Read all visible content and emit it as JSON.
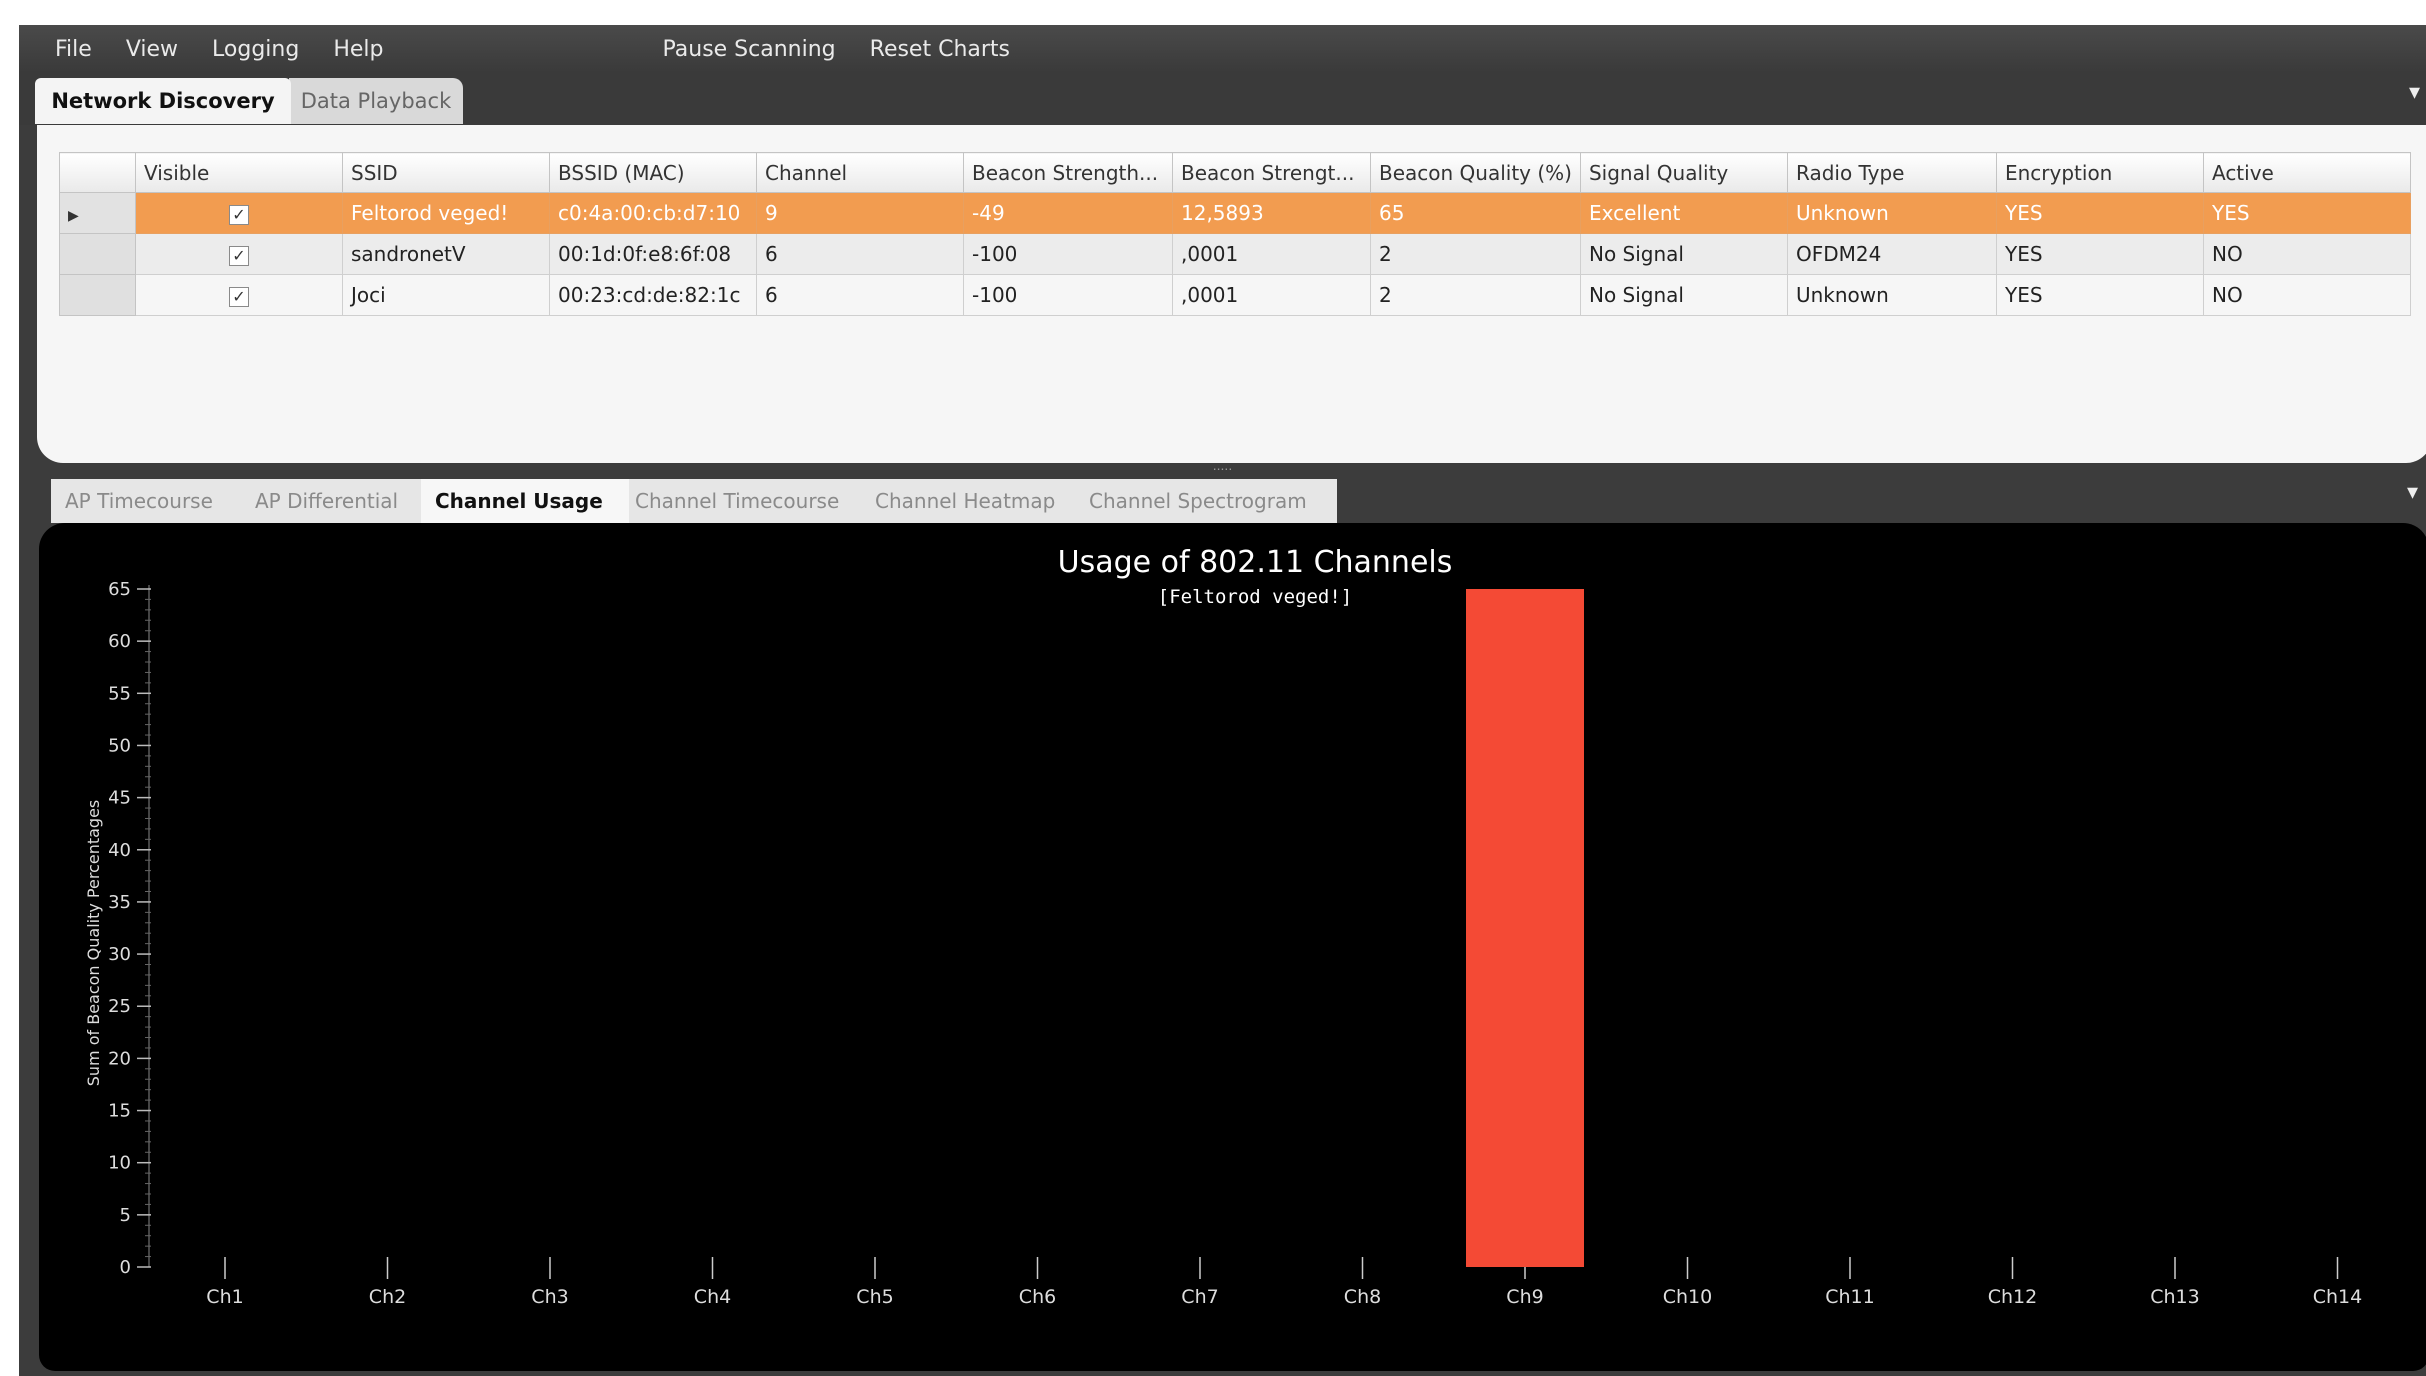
{
  "menu": {
    "file": "File",
    "view": "View",
    "logging": "Logging",
    "help": "Help",
    "pause_scanning": "Pause Scanning",
    "reset_charts": "Reset Charts"
  },
  "top_tabs": {
    "network_discovery": "Network Discovery",
    "data_playback": "Data Playback"
  },
  "grid": {
    "columns": [
      "Visible",
      "SSID",
      "BSSID (MAC)",
      "Channel",
      "Beacon  Strength...",
      "Beacon  Strengt...",
      "Beacon Quality (%)",
      "Signal Quality",
      "Radio Type",
      "Encryption",
      "Active"
    ],
    "rows": [
      {
        "visible": true,
        "ssid": "Feltorod veged!",
        "bssid": "c0:4a:00:cb:d7:10",
        "channel": "9",
        "beacon_strength_dbm": "-49",
        "beacon_strength_mw": "12,5893",
        "beacon_quality": "65",
        "signal_quality": "Excellent",
        "radio_type": "Unknown",
        "encryption": "YES",
        "active": "YES",
        "selected": true
      },
      {
        "visible": true,
        "ssid": "sandronetV",
        "bssid": "00:1d:0f:e8:6f:08",
        "channel": "6",
        "beacon_strength_dbm": "-100",
        "beacon_strength_mw": ",0001",
        "beacon_quality": "2",
        "signal_quality": "No Signal",
        "radio_type": "OFDM24",
        "encryption": "YES",
        "active": "NO",
        "selected": false
      },
      {
        "visible": true,
        "ssid": "Joci",
        "bssid": "00:23:cd:de:82:1c",
        "channel": "6",
        "beacon_strength_dbm": "-100",
        "beacon_strength_mw": ",0001",
        "beacon_quality": "2",
        "signal_quality": "No Signal",
        "radio_type": "Unknown",
        "encryption": "YES",
        "active": "NO",
        "selected": false
      }
    ],
    "checkmark": "✓"
  },
  "bottom_tabs": {
    "ap_timecourse": "AP Timecourse",
    "ap_differential": "AP Differential",
    "channel_usage": "Channel Usage",
    "channel_timecourse": "Channel Timecourse",
    "channel_heatmap": "Channel Heatmap",
    "channel_spectrogram": "Channel Spectrogram"
  },
  "colors": {
    "selected_row": "#f29c50",
    "bar": "#f44a35",
    "chart_background": "#000000"
  },
  "chart_data": {
    "type": "bar",
    "title": "Usage of 802.11 Channels",
    "subtitle": "[Feltorod veged!]",
    "ylabel": "Sum of Beacon Quality Percentages",
    "xlabel": "",
    "categories": [
      "Ch1",
      "Ch2",
      "Ch3",
      "Ch4",
      "Ch5",
      "Ch6",
      "Ch7",
      "Ch8",
      "Ch9",
      "Ch10",
      "Ch11",
      "Ch12",
      "Ch13",
      "Ch14"
    ],
    "values": [
      0,
      0,
      0,
      0,
      0,
      0,
      0,
      0,
      65,
      0,
      0,
      0,
      0,
      0
    ],
    "ylim": [
      0,
      65
    ],
    "yticks": [
      0,
      5,
      10,
      15,
      20,
      25,
      30,
      35,
      40,
      45,
      50,
      55,
      60,
      65
    ],
    "grid": false
  }
}
